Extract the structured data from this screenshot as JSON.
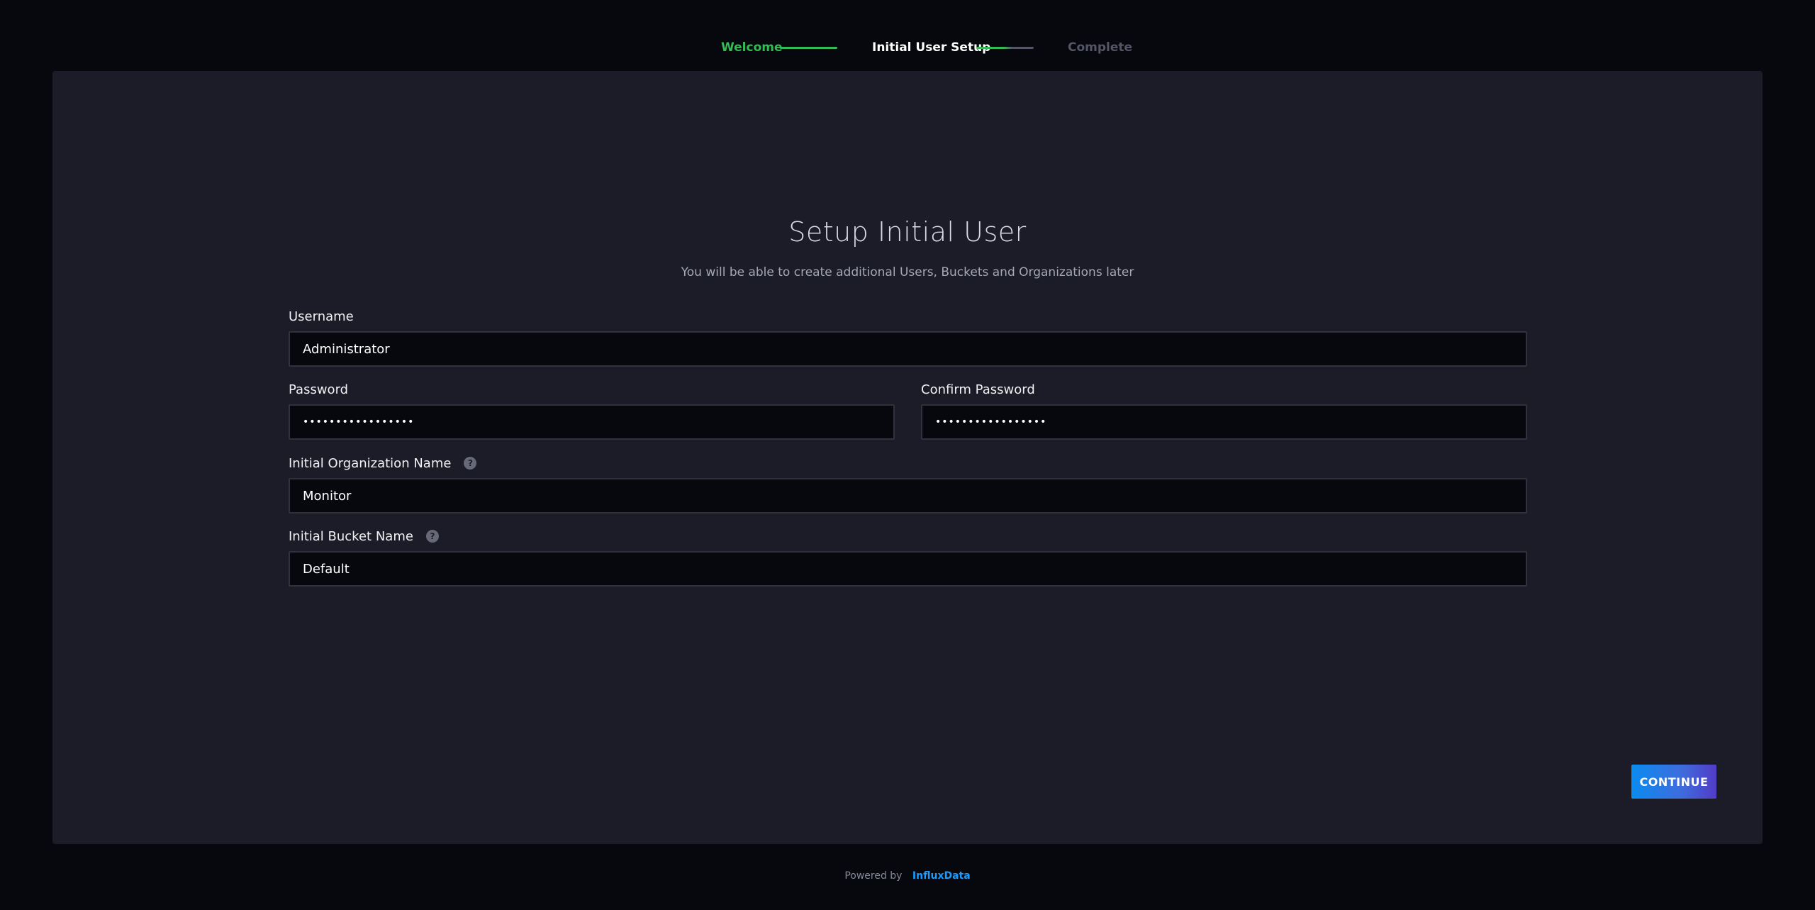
{
  "stepper": {
    "steps": [
      {
        "label": "Welcome",
        "state": "done"
      },
      {
        "label": "Initial User Setup",
        "state": "current"
      },
      {
        "label": "Complete",
        "state": "pending"
      }
    ]
  },
  "form": {
    "title": "Setup Initial User",
    "subtitle": "You will be able to create additional Users, Buckets and Organizations later",
    "username": {
      "label": "Username",
      "value": "Administrator"
    },
    "password": {
      "label": "Password",
      "value": "•••••••••••••••••"
    },
    "confirm_password": {
      "label": "Confirm Password",
      "value": "•••••••••••••••••"
    },
    "org_name": {
      "label": "Initial Organization Name",
      "value": "Monitor",
      "help_icon": "question-mark-icon"
    },
    "bucket_name": {
      "label": "Initial Bucket Name",
      "value": "Default",
      "help_icon": "question-mark-icon"
    }
  },
  "actions": {
    "continue_label": "CONTINUE"
  },
  "footer": {
    "powered_by": "Powered by",
    "brand": "InfluxData"
  },
  "colors": {
    "background": "#07080d",
    "panel": "#1c1c29",
    "step_done": "#34bb55",
    "step_pending": "#545667",
    "brand_blue": "#1a9bff"
  }
}
